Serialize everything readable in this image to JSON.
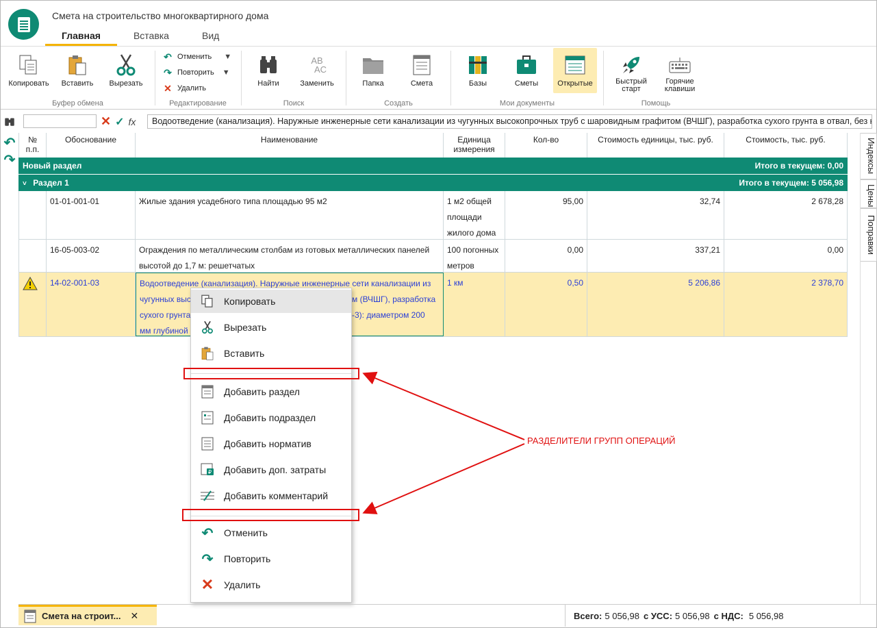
{
  "window": {
    "title": "Смета на строительство многоквартирного дома"
  },
  "tabs": [
    {
      "label": "Главная"
    },
    {
      "label": "Вставка"
    },
    {
      "label": "Вид"
    }
  ],
  "ribbon": {
    "clipboard": {
      "name": "Буфер обмена",
      "copy": "Копировать",
      "paste": "Вставить",
      "cut": "Вырезать"
    },
    "editing": {
      "name": "Редактирование",
      "undo": "Отменить",
      "redo": "Повторить",
      "delete": "Удалить"
    },
    "search": {
      "name": "Поиск",
      "find": "Найти",
      "replace": "Заменить"
    },
    "create": {
      "name": "Создать",
      "folder": "Папка",
      "estimate": "Смета"
    },
    "mydocs": {
      "name": "Мои документы",
      "bases": "Базы",
      "estimates": "Сметы",
      "open": "Открытые"
    },
    "help": {
      "name": "Помощь",
      "quickstart_1": "Быстрый",
      "quickstart_2": "старт",
      "hotkeys_1": "Горячие",
      "hotkeys_2": "клавиши"
    }
  },
  "formula_bar": {
    "fx": "fx",
    "text": "Водоотведение (канализация). Наружные инженерные сети канализации из чугунных высокопрочных труб с шаровидным графитом (ВЧШГ), разработка сухого грунта в отвал, без крепления"
  },
  "table": {
    "headers": {
      "num_1": "№",
      "num_2": "п.п.",
      "basis": "Обоснование",
      "name": "Наименование",
      "unit_1": "Единица",
      "unit_2": "измерения",
      "qty": "Кол-во",
      "unit_cost": "Стоимость единицы, тыс. руб.",
      "cost": "Стоимость, тыс. руб."
    },
    "sections": [
      {
        "label": "Новый раздел",
        "total": "Итого в текущем: 0,00"
      },
      {
        "label": "Раздел 1",
        "total": "Итого в текущем: 5 056,98"
      }
    ],
    "rows": [
      {
        "basis": "01-01-001-01",
        "name": "Жилые здания усадебного типа площадью 95 м2",
        "unit_1": "1 м2 общей",
        "unit_2": "площади",
        "unit_3": "жилого дома",
        "qty": "95,00",
        "unit_cost": "32,74",
        "cost": "2 678,28"
      },
      {
        "basis": "16-05-003-02",
        "name_1": "Ограждения по металлическим столбам из готовых металлических панелей",
        "name_2": "высотой до 1,7 м: решетчатых",
        "unit_1": "100 погонных",
        "unit_2": "метров",
        "qty": "0,00",
        "unit_cost": "337,21",
        "cost": "0,00"
      },
      {
        "basis": "14-02-001-03",
        "name_1": "Водоотведение (канализация). Наружные инженерные сети канализации из",
        "name_2a": "чугунных выс",
        "name_2b": "м (ВЧШГ), разработка",
        "name_3a": "сухого грунта",
        "name_3b": "-3): диаметром 200",
        "name_4": "мм глубиной",
        "unit_1": "1 км",
        "qty": "0,50",
        "unit_cost": "5 206,86",
        "cost": "2 378,70"
      }
    ]
  },
  "side_tabs": [
    "Индексы",
    "Цены",
    "Поправки"
  ],
  "context_menu": {
    "items": [
      {
        "label": "Копировать",
        "icon": "copy-icon"
      },
      {
        "label": "Вырезать",
        "icon": "scissors-icon"
      },
      {
        "label": "Вставить",
        "icon": "paste-icon"
      },
      {
        "label": "Добавить раздел",
        "icon": "section-icon"
      },
      {
        "label": "Добавить подраздел",
        "icon": "subsection-icon"
      },
      {
        "label": "Добавить норматив",
        "icon": "norm-icon"
      },
      {
        "label": "Добавить доп. затраты",
        "icon": "extra-cost-icon"
      },
      {
        "label": "Добавить комментарий",
        "icon": "comment-icon"
      },
      {
        "label": "Отменить",
        "icon": "undo-icon"
      },
      {
        "label": "Повторить",
        "icon": "redo-icon"
      },
      {
        "label": "Удалить",
        "icon": "delete-icon"
      }
    ]
  },
  "annotation": "РАЗДЕЛИТЕЛИ ГРУПП ОПЕРАЦИЙ",
  "bottom": {
    "doc_tab": "Смета на строит...",
    "total_label": "Всего:",
    "total_value": "5 056,98",
    "uss_label": "с УСС:",
    "uss_value": "5 056,98",
    "nds_label": "с НДС:",
    "nds_value": "5 056,98"
  },
  "colors": {
    "accent": "#0f8a74",
    "highlight": "#fdecb2",
    "tab_underline": "#f5b400",
    "annotation": "#e01010"
  }
}
